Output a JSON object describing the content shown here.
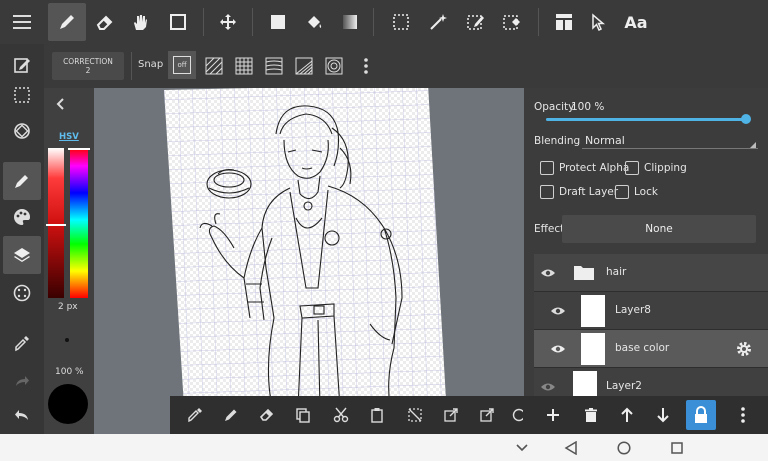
{
  "toolbar": {
    "icons": [
      "pen-icon",
      "eraser-icon",
      "hand-icon",
      "rectangle-icon",
      "move-icon",
      "fill-square-icon",
      "bucket-icon",
      "gradient-icon",
      "select-rect-icon",
      "magic-wand-icon",
      "select-pen-icon",
      "select-eraser-icon",
      "layout-icon",
      "cursor-icon",
      "text-tool-icon"
    ],
    "text_tool_label": "Aa"
  },
  "subbar": {
    "correction_label": "CORRECTION",
    "correction_value": "2",
    "snap_label": "Snap",
    "snap_off_label": "off"
  },
  "color_panel": {
    "mode_label": "HSV",
    "brush_size": "2 px",
    "opacity": "100 %"
  },
  "layer_props": {
    "opacity_label": "Opacity",
    "opacity_value": "100 %",
    "opacity_fraction": 1.0,
    "blending_label": "Blending",
    "blending_value": "Normal",
    "protect_alpha_label": "Protect Alpha",
    "clipping_label": "Clipping",
    "draft_layer_label": "Draft Layer",
    "lock_label": "Lock",
    "effect_label": "Effect",
    "effect_value": "None"
  },
  "layers": [
    {
      "name": "hair",
      "type": "folder"
    },
    {
      "name": "Layer8",
      "type": "layer"
    },
    {
      "name": "base color",
      "type": "layer",
      "selected": true
    },
    {
      "name": "Layer2",
      "type": "layer"
    }
  ],
  "colors": {
    "accent": "#4fb3e6",
    "lock_button": "#3a8fd6",
    "canvas_bg": "#6f747a"
  }
}
